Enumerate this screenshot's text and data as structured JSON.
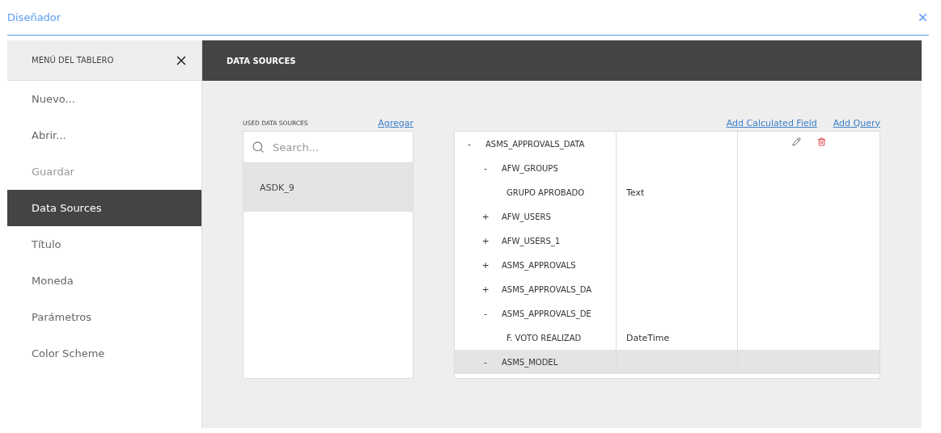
{
  "window": {
    "title": "Diseñador"
  },
  "sidebar": {
    "title": "MENÚ DEL TABLERO",
    "items": [
      {
        "label": "Nuevo...",
        "selected": false,
        "disabled": false
      },
      {
        "label": "Abrir...",
        "selected": false,
        "disabled": false
      },
      {
        "label": "Guardar",
        "selected": false,
        "disabled": true
      },
      {
        "label": "Data Sources",
        "selected": true,
        "disabled": false
      },
      {
        "label": "Título",
        "selected": false,
        "disabled": false
      },
      {
        "label": "Moneda",
        "selected": false,
        "disabled": false
      },
      {
        "label": "Parámetros",
        "selected": false,
        "disabled": false
      },
      {
        "label": "Color Scheme",
        "selected": false,
        "disabled": false
      }
    ]
  },
  "header": {
    "title": "DATA SOURCES"
  },
  "used_sources": {
    "title": "USED DATA SOURCES",
    "add_link": "Agregar",
    "search": {
      "placeholder": "Search..."
    },
    "items": [
      {
        "label": "ASDK_9",
        "selected": true
      }
    ]
  },
  "links": [
    "Add Calculated Field",
    "Add Query"
  ],
  "tree": [
    {
      "kind": "table",
      "toggle": "-",
      "label": "ASMS_APPROVALS_DATA",
      "selected": false,
      "actions": true,
      "children": [
        {
          "kind": "table",
          "toggle": "-",
          "label": "AFW_GROUPS",
          "selected": false,
          "children": [
            {
              "kind": "field",
              "label": "GRUPO APROBADO",
              "type": "Text",
              "selected": false
            }
          ]
        },
        {
          "kind": "table",
          "toggle": "+",
          "label": "AFW_USERS",
          "selected": false
        },
        {
          "kind": "table",
          "toggle": "+",
          "label": "AFW_USERS_1",
          "selected": false
        },
        {
          "kind": "table",
          "toggle": "+",
          "label": "ASMS_APPROVALS",
          "selected": false
        },
        {
          "kind": "table",
          "toggle": "+",
          "label": "ASMS_APPROVALS_DA",
          "selected": false
        },
        {
          "kind": "table",
          "toggle": "-",
          "label": "ASMS_APPROVALS_DE",
          "selected": false,
          "children": [
            {
              "kind": "field",
              "label": "F. VOTO REALIZAD",
              "type": "DateTime",
              "selected": false
            }
          ]
        },
        {
          "kind": "table",
          "toggle": "-",
          "label": "ASMS_MODEL",
          "selected": true
        }
      ]
    }
  ]
}
